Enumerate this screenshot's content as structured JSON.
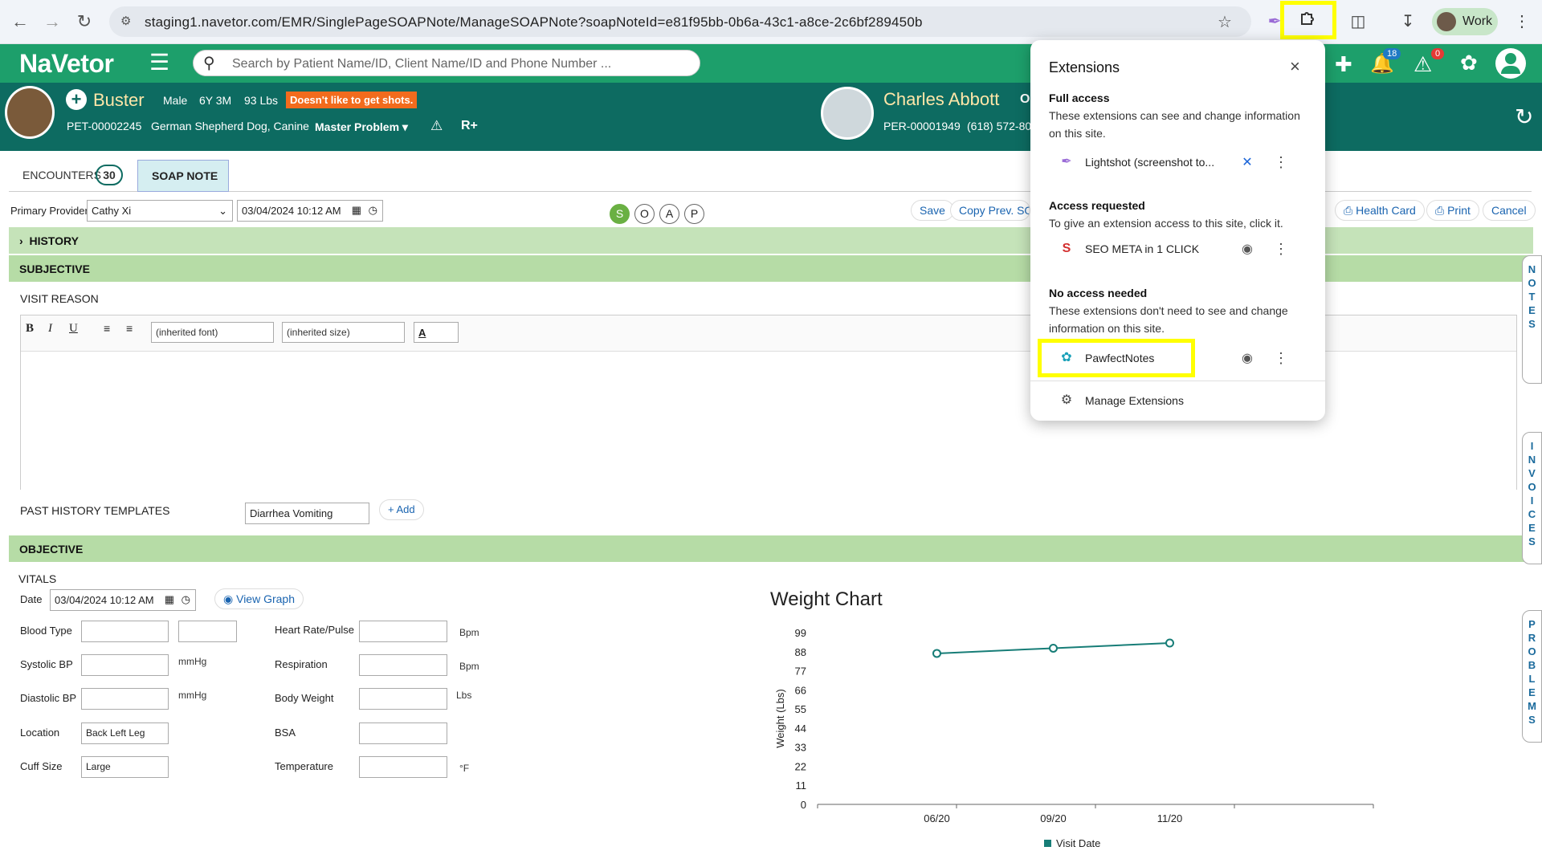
{
  "browser": {
    "url": "staging1.navetor.com/EMR/SinglePageSOAPNote/ManageSOAPNote?soapNoteId=e81f95bb-0b6a-43c1-a8ce-2c6bf289450b",
    "profile_label": "Work"
  },
  "app": {
    "brand": "NaVetor",
    "search_placeholder": "Search by Patient Name/ID, Client Name/ID and Phone Number ...",
    "notifications_count": "18",
    "alerts_count": "0"
  },
  "patient": {
    "name": "Buster",
    "sex": "Male",
    "age": "6Y 3M",
    "weight": "93 Lbs",
    "alert": "Doesn't like to get shots.",
    "id": "PET-00002245",
    "breed": "German Shepherd Dog, Canine",
    "master_problem": "Master Problem",
    "rx_label": "R+"
  },
  "client": {
    "name": "Charles Abbott",
    "name_tail": "O",
    "id": "PER-00001949",
    "phone": "(618) 572-80"
  },
  "tabs": {
    "encounters_label": "ENCOUNTERS",
    "encounters_count": "30",
    "soap_label": "SOAP NOTE"
  },
  "toolbar": {
    "provider_label": "Primary Provider",
    "provider_value": "Cathy Xi",
    "datetime": "03/04/2024 10:12 AM",
    "soap_letters": [
      "S",
      "O",
      "A",
      "P"
    ],
    "save": "Save",
    "copy_prev": "Copy Prev. SOA",
    "health_card": "Health Card",
    "print": "Print",
    "cancel": "Cancel"
  },
  "sections": {
    "history": "HISTORY",
    "subjective": "SUBJECTIVE",
    "visit_reason": "VISIT REASON",
    "objective": "OBJECTIVE"
  },
  "editor": {
    "font_placeholder": "(inherited font)",
    "size_placeholder": "(inherited size)"
  },
  "past_history": {
    "label": "PAST HISTORY TEMPLATES",
    "value": "Diarrhea Vomiting",
    "add": "+ Add"
  },
  "vitals": {
    "title": "VITALS",
    "date_label": "Date",
    "date_value": "03/04/2024 10:12 AM",
    "view_graph": "View Graph",
    "blood_type": "Blood Type",
    "systolic": "Systolic BP",
    "diastolic": "Diastolic BP",
    "location": "Location",
    "location_value": "Back Left Leg",
    "cuff": "Cuff Size",
    "cuff_value": "Large",
    "heart_rate": "Heart Rate/Pulse",
    "respiration": "Respiration",
    "body_weight": "Body Weight",
    "bsa": "BSA",
    "temperature": "Temperature",
    "unit_mmhg": "mmHg",
    "unit_bpm": "Bpm",
    "unit_lbs": "Lbs",
    "unit_f": "°F"
  },
  "side_tabs": {
    "notes": "NOTES",
    "invoices": "INVOICES",
    "problems": "PROBLEMS"
  },
  "chart_data": {
    "type": "line",
    "title": "Weight Chart",
    "ylabel": "Weight (Lbs)",
    "xlabel": "",
    "categories": [
      "06/20",
      "09/20",
      "11/20"
    ],
    "yticks": [
      0,
      11,
      22,
      33,
      44,
      55,
      66,
      77,
      88,
      99
    ],
    "ylim": [
      0,
      99
    ],
    "series": [
      {
        "name": "Visit Date",
        "values": [
          87,
          90,
          93
        ]
      }
    ],
    "legend_position": "bottom",
    "grid": false,
    "color": "#177d77"
  },
  "extensions": {
    "title": "Extensions",
    "full_access_heading": "Full access",
    "full_access_desc": "These extensions can see and change information on this site.",
    "full_access_items": [
      "Lightshot (screenshot to..."
    ],
    "requested_heading": "Access requested",
    "requested_desc": "To give an extension access to this site, click it.",
    "requested_items": [
      "SEO META in 1 CLICK"
    ],
    "none_heading": "No access needed",
    "none_desc": "These extensions don't need to see and change information on this site.",
    "none_items": [
      "PawfectNotes"
    ],
    "manage": "Manage Extensions"
  }
}
